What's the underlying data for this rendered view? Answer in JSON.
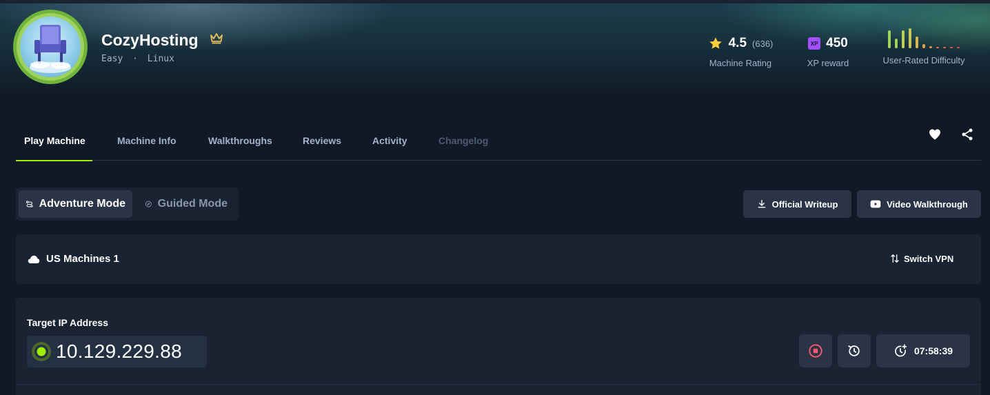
{
  "machine": {
    "name": "CozyHosting",
    "difficulty": "Easy",
    "os": "Linux",
    "meta_separator": "·"
  },
  "stats": {
    "rating": {
      "value": "4.5",
      "count": "(636)",
      "label": "Machine Rating"
    },
    "xp": {
      "badge": "XP",
      "value": "450",
      "label": "XP reward"
    },
    "difficulty": {
      "label": "User-Rated Difficulty",
      "bars": [
        {
          "level": 0.85,
          "color": "#9fd15d"
        },
        {
          "level": 0.45,
          "color": "#9fd15d"
        },
        {
          "level": 0.85,
          "color": "#b9cf5a"
        },
        {
          "level": 0.95,
          "color": "#c9c456"
        },
        {
          "level": 0.55,
          "color": "#d6b552"
        },
        {
          "level": 0.2,
          "color": "#dca34f"
        },
        {
          "level": 0.1,
          "color": "#e08f4b"
        },
        {
          "level": 0.05,
          "color": "#e27a47"
        },
        {
          "level": 0.05,
          "color": "#e46844"
        },
        {
          "level": 0.05,
          "color": "#e45a42"
        },
        {
          "level": 0.05,
          "color": "#e44f40"
        }
      ]
    }
  },
  "tabs": [
    {
      "label": "Play Machine",
      "state": "active"
    },
    {
      "label": "Machine Info",
      "state": "normal"
    },
    {
      "label": "Walkthroughs",
      "state": "normal"
    },
    {
      "label": "Reviews",
      "state": "normal"
    },
    {
      "label": "Activity",
      "state": "normal"
    },
    {
      "label": "Changelog",
      "state": "disabled"
    }
  ],
  "modes": {
    "adventure": "Adventure Mode",
    "guided": "Guided Mode"
  },
  "actions": {
    "writeup": "Official Writeup",
    "video": "Video Walkthrough"
  },
  "vpn": {
    "name": "US Machines 1",
    "switch_label": "Switch VPN"
  },
  "target": {
    "label": "Target IP Address",
    "ip": "10.129.229.88",
    "timer": "07:58:39"
  },
  "colors": {
    "accent": "#9fef00",
    "star": "#ffcc3d",
    "xp": "#a050ff",
    "stop": "#ff5a6e",
    "crown": "#e6c25a"
  }
}
